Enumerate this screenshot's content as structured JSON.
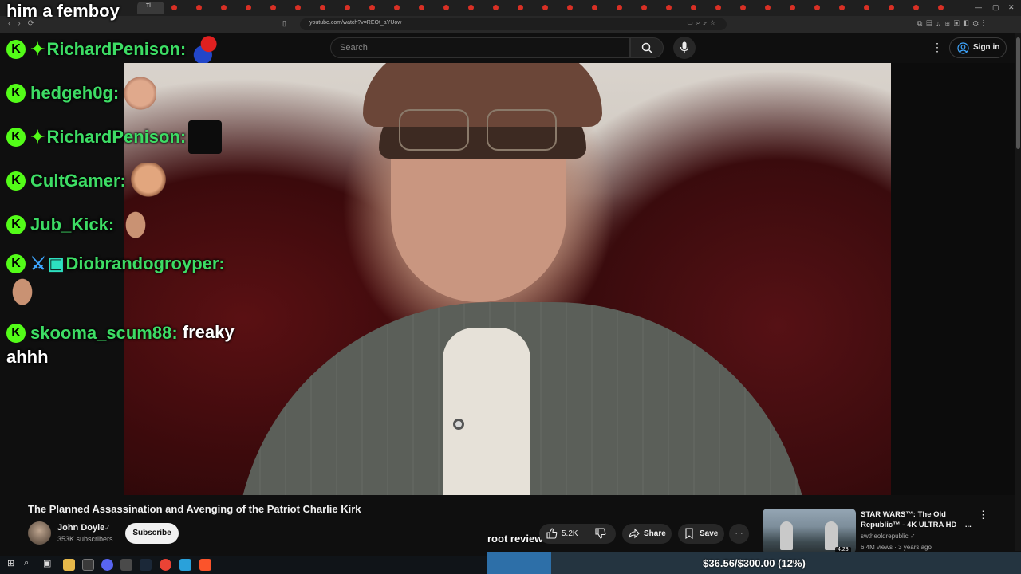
{
  "browser": {
    "active_tab_label": "Tl",
    "url": "youtube.com/watch?v=REOt_aYUow"
  },
  "youtube": {
    "search_placeholder": "Search",
    "sign_in": "Sign in"
  },
  "chat": {
    "top_line": "him a femboy",
    "messages": [
      {
        "user": "RichardPenison:",
        "text": ""
      },
      {
        "user": "hedgeh0g:",
        "text": ""
      },
      {
        "user": "RichardPenison:",
        "text": ""
      },
      {
        "user": "CultGamer:",
        "text": ""
      },
      {
        "user": "Jub_Kick:",
        "text": ""
      },
      {
        "user": "Diobrandogroyper:",
        "text": ""
      },
      {
        "user": "skooma_scum88:",
        "text": "freaky",
        "text_wrap": "ahhh"
      }
    ],
    "badge_letter": "K"
  },
  "video": {
    "title": "The Planned Assassination and Avenging of the Patriot Charlie Kirk",
    "channel": "John Doyle",
    "subscribers": "353K subscribers",
    "subscribe_label": "Subscribe",
    "likes": "5.2K",
    "share_label": "Share",
    "save_label": "Save"
  },
  "overlay": {
    "root_review": "root review",
    "goal_text": "$36.56/$300.00 (12%)",
    "goal_fraction": 0.12
  },
  "recommended": {
    "title": "STAR WARS™: The Old Republic™ - 4K ULTRA HD – ...",
    "channel": "swtheoldrepublic",
    "meta": "6.4M views · 3 years ago",
    "duration": "4:23"
  },
  "colors": {
    "kick_green": "#53fc18",
    "chat_name": "#3ddc64",
    "yt_bg": "#0f0f0f"
  }
}
